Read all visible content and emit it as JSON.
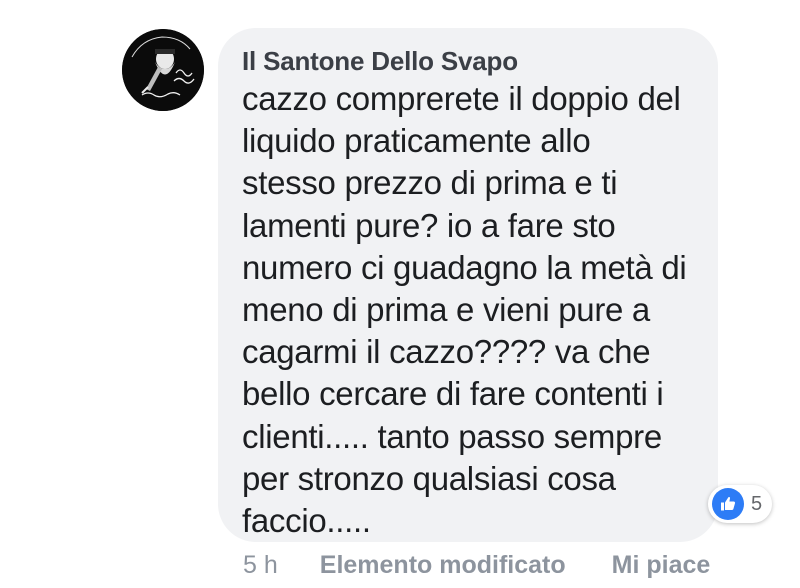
{
  "comment": {
    "author": "Il Santone Dello Svapo",
    "avatar_text": "il Santone dello Svapo",
    "body_lines": [
      "cazzo comprerete il doppio del",
      "liquido praticamente allo",
      "stesso prezzo di prima e ti",
      "lamenti pure? io a fare sto",
      "numero ci guadagno la metà di",
      "meno di prima e vieni pure a",
      "cagarmi il cazzo???? va che",
      "bello cercare di fare contenti i",
      "clienti..... tanto passo sempre",
      "per stronzo qualsiasi cosa",
      "faccio....."
    ],
    "reactions": {
      "icon": "thumbs-up-icon",
      "count": "5",
      "color": "#2d7cf6"
    },
    "meta": {
      "time": "5 h",
      "edited_label": "Elemento modificato",
      "like_label": "Mi piace"
    }
  },
  "colors": {
    "bubble": "#f1f2f4",
    "author": "#3b3f46",
    "text": "#1c1e21",
    "meta": "#8d949e"
  }
}
